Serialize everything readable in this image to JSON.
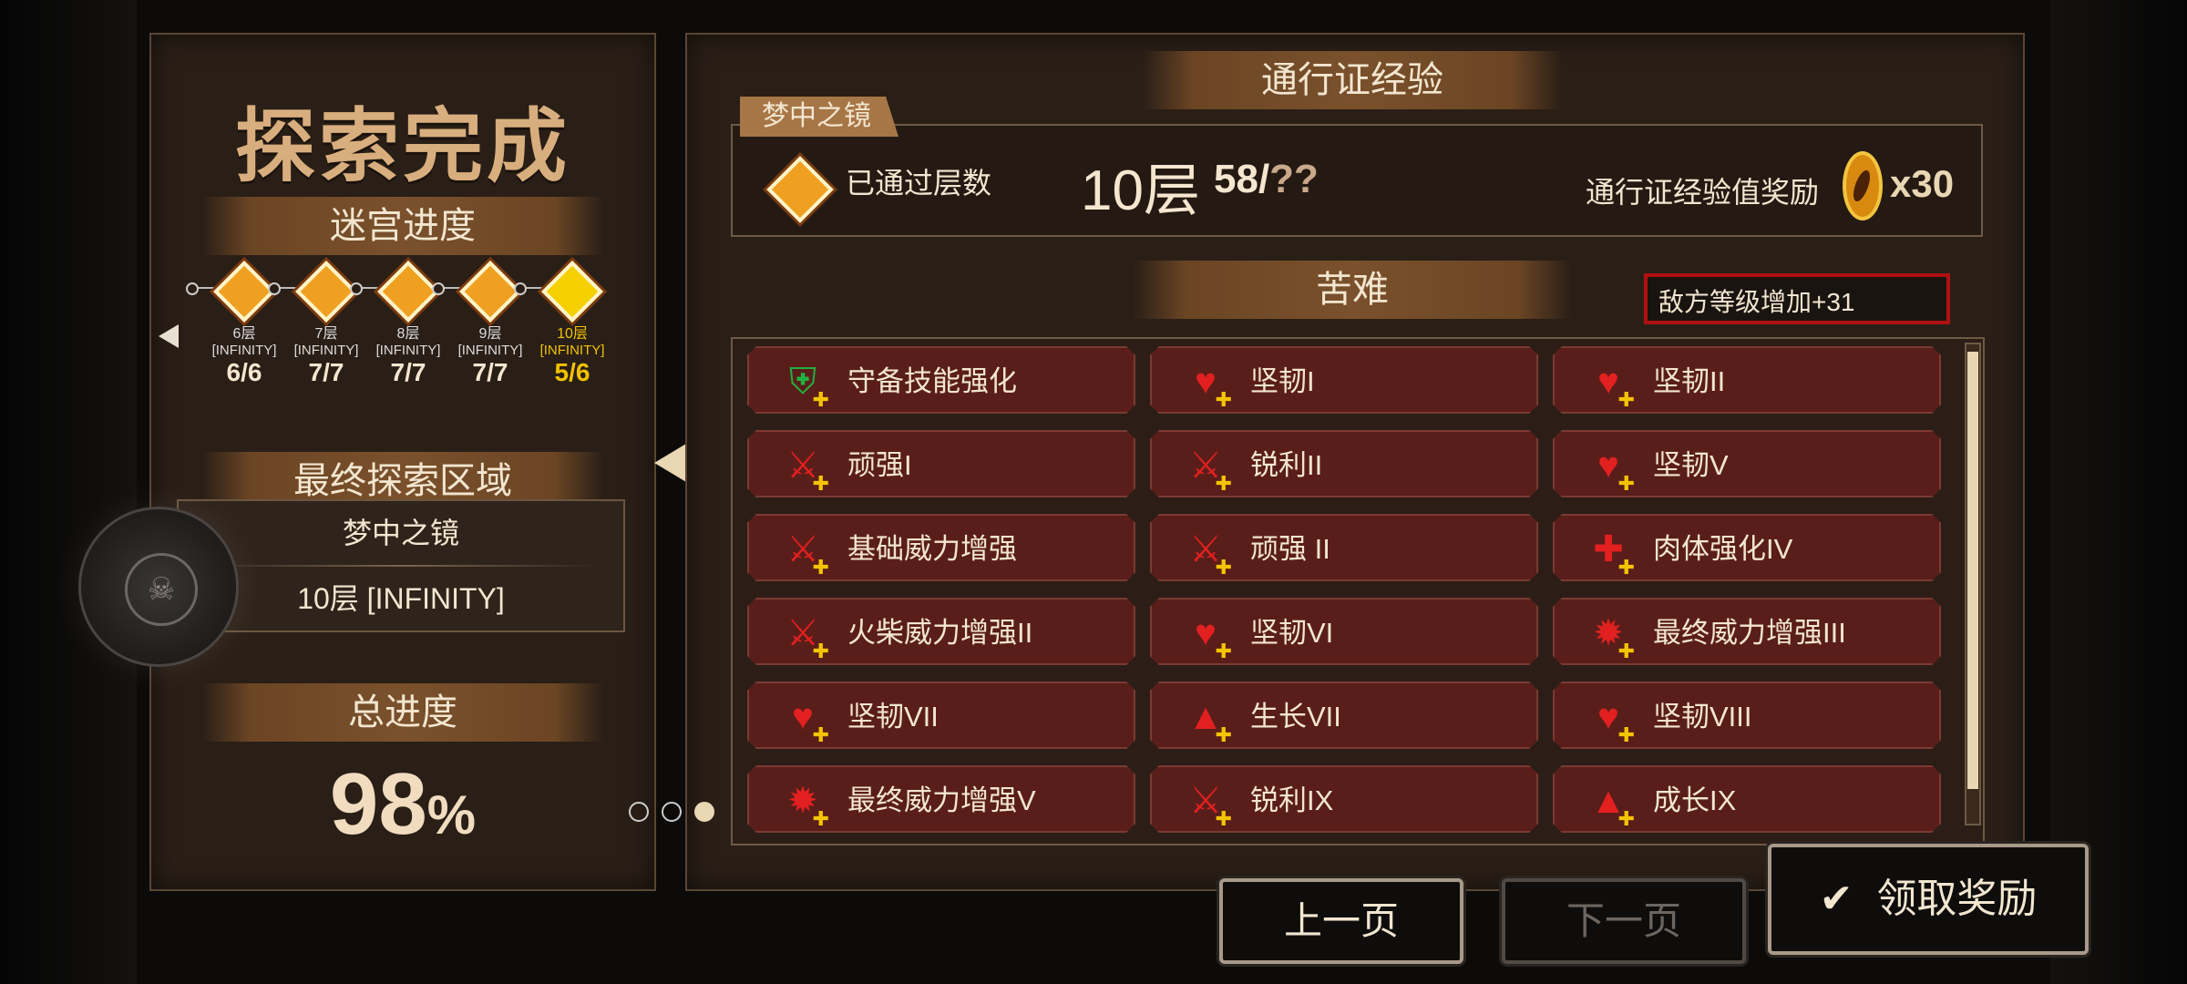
{
  "left": {
    "title": "探索完成",
    "maze_progress_label": "迷宫进度",
    "nodes": [
      {
        "floor": "6层",
        "mode": "[INFINITY]",
        "count": "6/6",
        "current": false
      },
      {
        "floor": "7层",
        "mode": "[INFINITY]",
        "count": "7/7",
        "current": false
      },
      {
        "floor": "8层",
        "mode": "[INFINITY]",
        "count": "7/7",
        "current": false
      },
      {
        "floor": "9层",
        "mode": "[INFINITY]",
        "count": "7/7",
        "current": false
      },
      {
        "floor": "10层",
        "mode": "[INFINITY]",
        "count": "5/6",
        "current": true
      }
    ],
    "final_area_label": "最终探索区域",
    "final_area_name": "梦中之镜",
    "final_area_floor": "10层 [INFINITY]",
    "total_progress_label": "总进度",
    "total_progress_value": "98",
    "total_progress_unit": "%"
  },
  "right": {
    "pass_exp_label": "通行证经验",
    "tab_label": "梦中之镜",
    "passed_floors_label": "已通过层数",
    "floor_value": "10层",
    "floor_count": "58/",
    "floor_count_unknown": "??",
    "reward_label": "通行证经验值奖励",
    "reward_multiplier": "x30",
    "hardship_label": "苦难",
    "enemy_level_text": "敌方等级增加+31",
    "modifiers": [
      {
        "label": "守备技能强化",
        "icon": "shield-icon",
        "color": "#22b040"
      },
      {
        "label": "坚韧I",
        "icon": "heart-shield-icon",
        "color": "#e22020"
      },
      {
        "label": "坚韧II",
        "icon": "heart-shield-icon",
        "color": "#e22020"
      },
      {
        "label": "顽强I",
        "icon": "sword-icon",
        "color": "#e22020"
      },
      {
        "label": "锐利II",
        "icon": "sword-icon",
        "color": "#e22020"
      },
      {
        "label": "坚韧V",
        "icon": "heart-shield-icon",
        "color": "#e22020"
      },
      {
        "label": "基础威力增强",
        "icon": "sword-icon",
        "color": "#e22020"
      },
      {
        "label": "顽强 II",
        "icon": "sword-icon",
        "color": "#e22020"
      },
      {
        "label": "肉体强化IV",
        "icon": "body-icon",
        "color": "#e22020"
      },
      {
        "label": "火柴威力增强II",
        "icon": "sword-icon",
        "color": "#e22020"
      },
      {
        "label": "坚韧VI",
        "icon": "heart-shield-icon",
        "color": "#e22020"
      },
      {
        "label": "最终威力增强III",
        "icon": "power-icon",
        "color": "#e22020"
      },
      {
        "label": "坚韧VII",
        "icon": "heart-shield-icon",
        "color": "#e22020"
      },
      {
        "label": "生长VII",
        "icon": "growth-icon",
        "color": "#e22020"
      },
      {
        "label": "坚韧VIII",
        "icon": "heart-shield-icon",
        "color": "#e22020"
      },
      {
        "label": "最终威力增强V",
        "icon": "power-icon",
        "color": "#e22020"
      },
      {
        "label": "锐利IX",
        "icon": "sword-icon",
        "color": "#e22020"
      },
      {
        "label": "成长IX",
        "icon": "growth-icon",
        "color": "#e22020"
      }
    ]
  },
  "pagination": {
    "total": 3,
    "current": 3
  },
  "buttons": {
    "prev": "上一页",
    "next": "下一页",
    "claim": "领取奖励"
  }
}
